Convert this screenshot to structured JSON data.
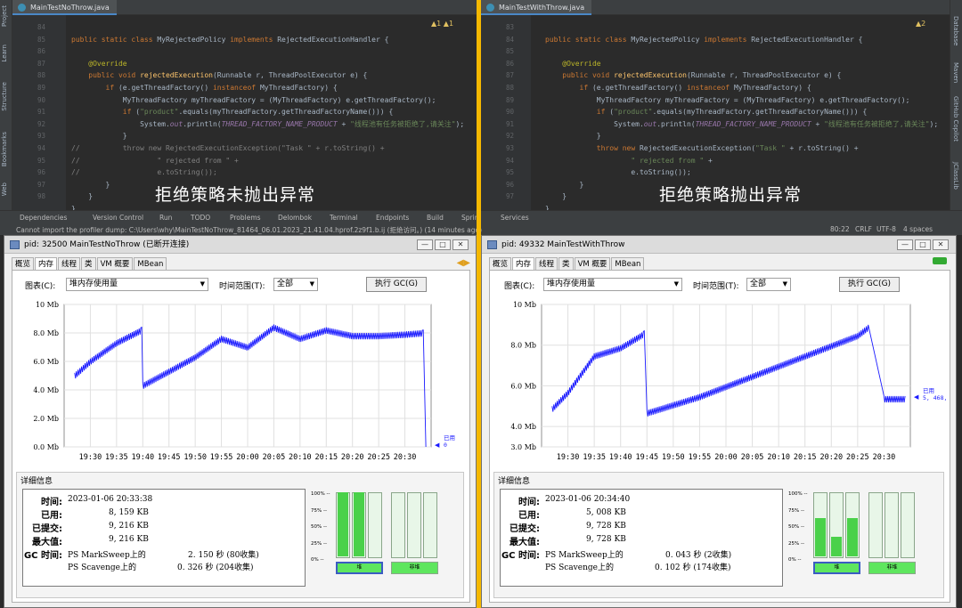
{
  "ide": {
    "left_strip": [
      "Project",
      "Learn",
      "Structure",
      "Bookmarks",
      "Web"
    ],
    "right_strip": [
      "Database",
      "Maven",
      "GitHub Copilot",
      "JClassLib"
    ],
    "left_pane": {
      "tab": "MainTestNoThrow.java",
      "warnings": "▲1 ▲1",
      "overlay": "拒绝策略未抛出异常",
      "lines": [
        "84",
        "85",
        "86",
        "87",
        "88",
        "89",
        "90",
        "91",
        "92",
        "93",
        "94",
        "95",
        "96",
        "97",
        "98"
      ],
      "code": {
        "l84": "public static class MyRejectedPolicy implements RejectedExecutionHandler {",
        "l86": "@Override",
        "l87": "public void rejectedExecution(Runnable r, ThreadPoolExecutor e) {",
        "l88": "if (e.getThreadFactory() instanceof MyThreadFactory) {",
        "l89": "MyThreadFactory myThreadFactory = (MyThreadFactory) e.getThreadFactory();",
        "l90": "if (\"product\".equals(myThreadFactory.getThreadFactoryName())) {",
        "l91": "System.out.println(THREAD_FACTORY_NAME_PRODUCT + \"线程池有任务被拒绝了,请关注\");",
        "l92": "}",
        "l93": "throw new RejectedExecutionException(\"Task \" + r.toString() +",
        "l94": "\" rejected from \" +",
        "l95": "e.toString());",
        "l96": "}",
        "l97": "}",
        "l98": "}"
      }
    },
    "right_pane": {
      "tab": "MainTestWithThrow.java",
      "warnings": "▲2",
      "overlay": "拒绝策略抛出异常",
      "lines": [
        "83",
        "84",
        "85",
        "86",
        "87",
        "88",
        "89",
        "90",
        "91",
        "92",
        "93",
        "94",
        "95",
        "96",
        "97"
      ]
    },
    "toolbar": [
      "Dependencies",
      "Version Control",
      "Run",
      "TODO",
      "Problems",
      "Delombok",
      "Terminal",
      "Endpoints",
      "Build",
      "Sprin",
      "Services"
    ],
    "status": {
      "message": "Cannot import the profiler dump: C:\\Users\\why\\MainTestNoThrow_81464_06.01.2023_21.41.04.hprof.2z9f1.b.ij (拒绝访问。) (14 minutes ago)",
      "position": "80:22",
      "line_sep": "CRLF",
      "encoding": "UTF-8",
      "indent": "4 spaces"
    }
  },
  "colors": {
    "accent_divider": "#f5b800",
    "heap_line": "#1a1aff",
    "bar_fill": "#4ad14a"
  },
  "left_window": {
    "title": "pid: 32500 MainTestNoThrow (已断开连接)",
    "tabs": [
      "概览",
      "内存",
      "线程",
      "类",
      "VM 概要",
      "MBean"
    ],
    "selected_tab": "内存",
    "chart_label": "图表(C):",
    "chart_value": "堆内存使用量",
    "range_label": "时间范围(T):",
    "range_value": "全部",
    "gc_button": "执行 GC(G)",
    "details_title": "详细信息",
    "time_label": "时间:",
    "time_value": "2023-01-06 20:33:38",
    "used_label": "已用:",
    "used_value": "8, 159 KB",
    "committed_label": "已提交:",
    "committed_value": "9, 216 KB",
    "max_label": "最大值:",
    "max_value": "9, 216 KB",
    "gc_label": "GC 时间:",
    "gc1_name": "PS MarkSweep上的",
    "gc1_value": "2. 150 秒 (80收集)",
    "gc2_name": "PS Scavenge上的",
    "gc2_value": "0. 326 秒 (204收集)",
    "heap_btn": "堆",
    "nonheap_btn": "非堆",
    "legend_label": "已用",
    "legend_value": "0"
  },
  "right_window": {
    "title": "pid: 49332 MainTestWithThrow",
    "tabs": [
      "概览",
      "内存",
      "线程",
      "类",
      "VM 概要",
      "MBean"
    ],
    "selected_tab": "内存",
    "chart_label": "图表(C):",
    "chart_value": "堆内存使用量",
    "range_label": "时间范围(T):",
    "range_value": "全部",
    "gc_button": "执行 GC(G)",
    "details_title": "详细信息",
    "time_label": "时间:",
    "time_value": "2023-01-06 20:34:40",
    "used_label": "已用:",
    "used_value": "5, 008 KB",
    "committed_label": "已提交:",
    "committed_value": "9, 728 KB",
    "max_label": "最大值:",
    "max_value": "9, 728 KB",
    "gc_label": "GC 时间:",
    "gc1_name": "PS MarkSweep上的",
    "gc1_value": "0. 043 秒 (2收集)",
    "gc2_name": "PS Scavenge上的",
    "gc2_value": "0. 102 秒 (174收集)",
    "heap_btn": "堆",
    "nonheap_btn": "非堆",
    "legend_label": "已用",
    "legend_value": "5, 468, 072"
  },
  "chart_data": [
    {
      "type": "line",
      "title": "",
      "xlabel": "",
      "ylabel": "",
      "y_ticks": [
        "0.0 Mb",
        "2.0 Mb",
        "4.0 Mb",
        "6.0 Mb",
        "8.0 Mb",
        "10 Mb"
      ],
      "x_ticks": [
        "19:30",
        "19:35",
        "19:40",
        "19:45",
        "19:50",
        "19:55",
        "20:00",
        "20:05",
        "20:10",
        "20:15",
        "20:20",
        "20:25",
        "20:30"
      ],
      "ylim": [
        0,
        10
      ],
      "series": [
        {
          "name": "已用",
          "x_minutes_from_19_30": [
            -3,
            0,
            5,
            9.8,
            10,
            15,
            20,
            25,
            30,
            35,
            40,
            45,
            50,
            55,
            60,
            63.5,
            64
          ],
          "values": [
            5.2,
            6.2,
            7.5,
            8.4,
            4.5,
            5.5,
            6.5,
            7.8,
            7.2,
            8.6,
            7.8,
            8.4,
            8.0,
            8.0,
            8.1,
            8.2,
            0
          ]
        }
      ]
    },
    {
      "type": "line",
      "title": "",
      "xlabel": "",
      "ylabel": "",
      "y_ticks": [
        "3.0 Mb",
        "4.0 Mb",
        "6.0 Mb",
        "8.0 Mb",
        "10 Mb"
      ],
      "x_ticks": [
        "19:30",
        "19:35",
        "19:40",
        "19:45",
        "19:50",
        "19:55",
        "20:00",
        "20:05",
        "20:10",
        "20:15",
        "20:20",
        "20:25",
        "20:30"
      ],
      "ylim": [
        3,
        10
      ],
      "series": [
        {
          "name": "已用",
          "x_minutes_from_19_30": [
            -3,
            0,
            5,
            10,
            14.5,
            15,
            20,
            25,
            30,
            35,
            40,
            45,
            50,
            55,
            57,
            60,
            64
          ],
          "values": [
            5.0,
            5.8,
            7.6,
            8.0,
            8.7,
            4.8,
            5.2,
            5.6,
            6.1,
            6.6,
            7.1,
            7.6,
            8.1,
            8.6,
            9.0,
            5.5,
            5.5
          ]
        }
      ]
    }
  ],
  "memory_bars": {
    "left": [
      1.0,
      1.0,
      0,
      0,
      0
    ],
    "right": [
      0.6,
      0.3,
      0.6,
      0,
      0
    ]
  },
  "bar_ticks": [
    "100% --",
    "75% --",
    "50% --",
    "25% --",
    "0% --"
  ]
}
